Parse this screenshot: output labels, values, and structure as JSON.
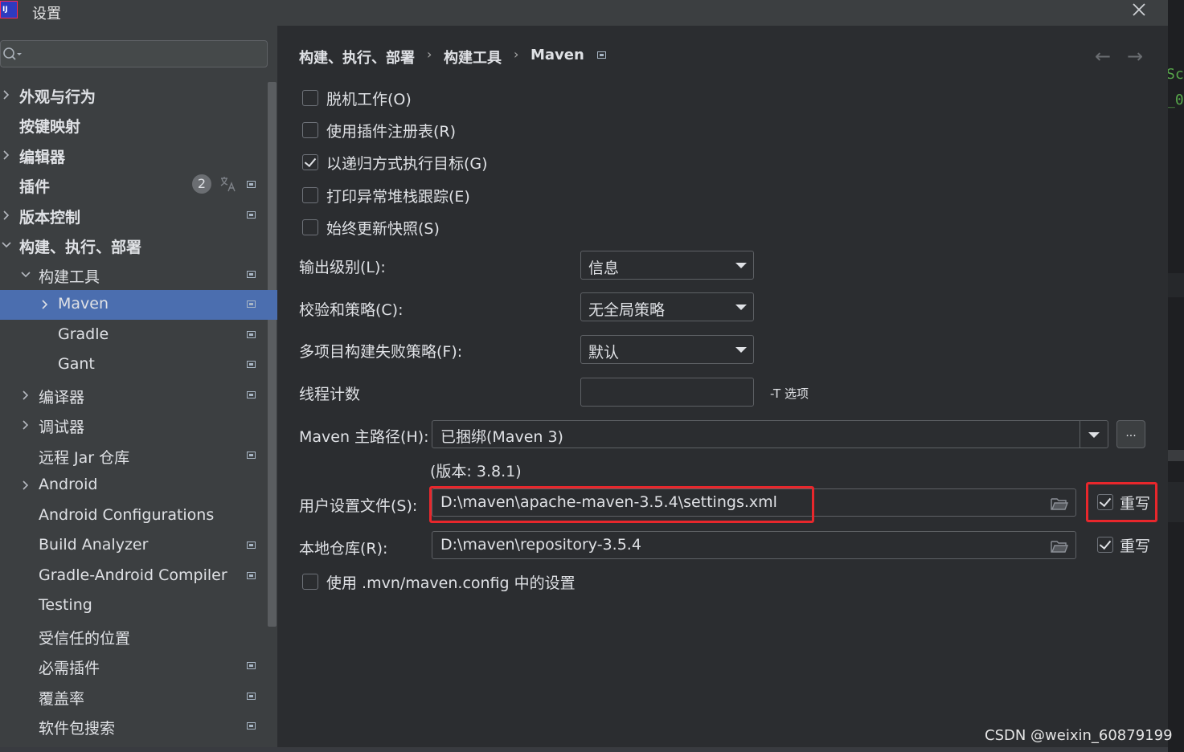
{
  "window": {
    "title": "设置",
    "logo_text": "IJ"
  },
  "sidebar": {
    "search_placeholder": "",
    "plugins_badge": "2",
    "items": [
      {
        "label": "外观与行为"
      },
      {
        "label": "按键映射"
      },
      {
        "label": "编辑器"
      },
      {
        "label": "插件"
      },
      {
        "label": "版本控制"
      },
      {
        "label": "构建、执行、部署"
      },
      {
        "label": "构建工具"
      },
      {
        "label": "Maven"
      },
      {
        "label": "Gradle"
      },
      {
        "label": "Gant"
      },
      {
        "label": "编译器"
      },
      {
        "label": "调试器"
      },
      {
        "label": "远程 Jar 仓库"
      },
      {
        "label": "Android"
      },
      {
        "label": "Android Configurations"
      },
      {
        "label": "Build Analyzer"
      },
      {
        "label": "Gradle-Android Compiler"
      },
      {
        "label": "Testing"
      },
      {
        "label": "受信任的位置"
      },
      {
        "label": "必需插件"
      },
      {
        "label": "覆盖率"
      },
      {
        "label": "软件包搜索"
      }
    ]
  },
  "breadcrumb": [
    "构建、执行、部署",
    "构建工具",
    "Maven"
  ],
  "breadcrumb_separator": "›",
  "nav": {
    "back": "←",
    "forward": "→"
  },
  "options": {
    "offline": {
      "label": "脱机工作(O)",
      "checked": false
    },
    "plugin_registry": {
      "label": "使用插件注册表(R)",
      "checked": false
    },
    "recursive": {
      "label": "以递归方式执行目标(G)",
      "checked": true
    },
    "print_stack": {
      "label": "打印异常堆栈跟踪(E)",
      "checked": false
    },
    "always_update": {
      "label": "始终更新快照(S)",
      "checked": false
    }
  },
  "fields": {
    "output_level": {
      "label": "输出级别(L):",
      "value": "信息"
    },
    "checksum": {
      "label": "校验和策略(C):",
      "value": "无全局策略"
    },
    "multiproject": {
      "label": "多项目构建失败策略(F):",
      "value": "默认"
    },
    "threads": {
      "label": "线程计数",
      "value": "",
      "hint": "-T 选项"
    },
    "maven_home": {
      "label": "Maven 主路径(H):",
      "value": "已捆绑(Maven 3)",
      "browse": "...",
      "version": "(版本: 3.8.1)"
    },
    "user_settings": {
      "label": "用户设置文件(S):",
      "value": "D:\\maven\\apache-maven-3.5.4\\settings.xml",
      "override": "重写",
      "override_checked": true
    },
    "local_repo": {
      "label": "本地仓库(R):",
      "value": "D:\\maven\\repository-3.5.4",
      "override": "重写",
      "override_checked": true
    },
    "mvn_config": {
      "label": "使用 .mvn/maven.config 中的设置",
      "checked": false
    }
  },
  "right_strip_code": [
    "Sc",
    "_0"
  ],
  "watermark": "CSDN @weixin_60879199",
  "colors": {
    "selection": "#4b6eaf",
    "highlight_box": "#e8272c",
    "background": "#2b2d30",
    "sidebar": "#3c3f41"
  }
}
